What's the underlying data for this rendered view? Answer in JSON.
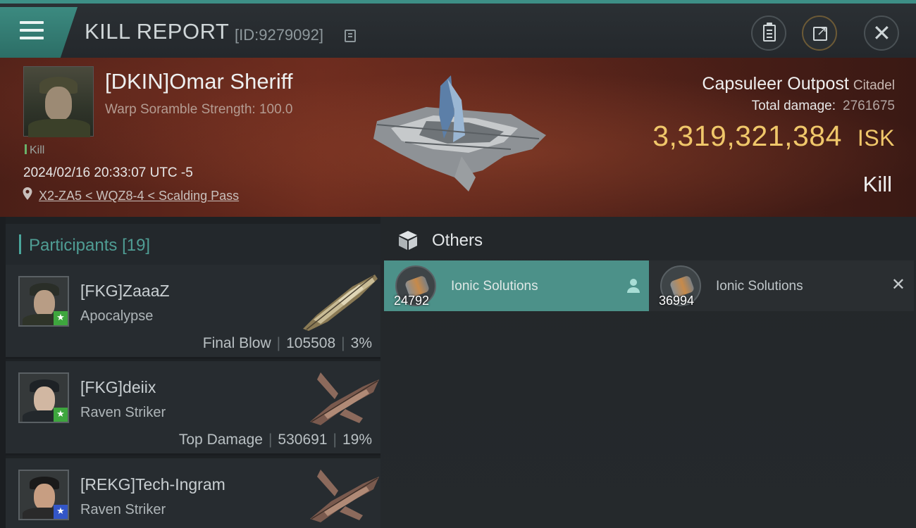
{
  "header": {
    "title": "KILL REPORT",
    "report_id": "[ID:9279092]"
  },
  "victim": {
    "name": "[DKIN]Omar Sheriff",
    "warp_scramble": "Warp Soramble Strength: 100.0",
    "tag": "Kill",
    "timestamp": "2024/02/16 20:33:07 UTC -5",
    "location": "X2-ZA5 < WQZ8-4 < Scalding Pass",
    "ship_type": "Capsuleer Outpost",
    "ship_class": "Citadel",
    "total_damage_label": "Total damage:",
    "total_damage_value": "2761675",
    "isk_value": "3,319,321,384",
    "isk_unit": "ISK",
    "result": "Kill"
  },
  "participants": {
    "label": "Participants",
    "count": "[19]",
    "rows": [
      {
        "name": "[FKG]ZaaaZ",
        "ship": "Apocalypse",
        "role": "Final Blow",
        "damage": "105508",
        "percent": "3%"
      },
      {
        "name": "[FKG]deiix",
        "ship": "Raven Striker",
        "role": "Top Damage",
        "damage": "530691",
        "percent": "19%"
      },
      {
        "name": "[REKG]Tech-Ingram",
        "ship": "Raven Striker",
        "role": "",
        "damage": "",
        "percent": ""
      }
    ]
  },
  "others": {
    "title": "Others",
    "items": [
      {
        "name": "Ionic Solutions",
        "count": "24792"
      },
      {
        "name": "Ionic Solutions",
        "count": "36994"
      }
    ]
  },
  "colors": {
    "accent": "#4c9189",
    "isk": "#f0c76a",
    "star_green": "#3ea63e",
    "star_blue": "#3356c7"
  }
}
